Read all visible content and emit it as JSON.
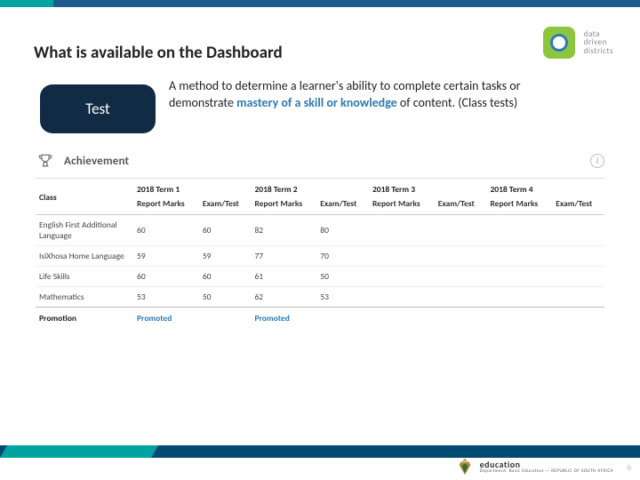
{
  "header": {
    "title": "What is available on the Dashboard",
    "logo_lines": [
      "data",
      "driven",
      "districts"
    ]
  },
  "definition": {
    "pill_label": "Test",
    "text_before": "A method to determine a learner's ability to complete certain tasks or demonstrate ",
    "text_emph": "mastery of a skill or knowledge",
    "text_after": " of content. (Class tests)"
  },
  "panel": {
    "title": "Achievement",
    "col_class": "Class",
    "terms": [
      "2018 Term 1",
      "2018 Term 2",
      "2018 Term 3",
      "2018 Term 4"
    ],
    "subcols": [
      "Report Marks",
      "Exam/Test"
    ],
    "rows": [
      {
        "class": "English First Additional Language",
        "vals": [
          "60",
          "60",
          "82",
          "80",
          "",
          "",
          "",
          ""
        ]
      },
      {
        "class": "IsiXhosa Home Language",
        "vals": [
          "59",
          "59",
          "77",
          "70",
          "",
          "",
          "",
          ""
        ]
      },
      {
        "class": "Life Skills",
        "vals": [
          "60",
          "60",
          "61",
          "50",
          "",
          "",
          "",
          ""
        ]
      },
      {
        "class": "Mathematics",
        "vals": [
          "53",
          "50",
          "62",
          "53",
          "",
          "",
          "",
          ""
        ]
      }
    ],
    "footer_label": "Promotion",
    "footer_vals": [
      "Promoted",
      "",
      "Promoted",
      "",
      "",
      "",
      "",
      ""
    ]
  },
  "footer": {
    "edu_top": "education",
    "edu_sub": "Department: Basic Education — REPUBLIC OF SOUTH AFRICA",
    "page_number": "6"
  },
  "chart_data": {
    "type": "table",
    "title": "Achievement",
    "columns": [
      "Class",
      "2018 Term 1 Report Marks",
      "2018 Term 1 Exam/Test",
      "2018 Term 2 Report Marks",
      "2018 Term 2 Exam/Test",
      "2018 Term 3 Report Marks",
      "2018 Term 3 Exam/Test",
      "2018 Term 4 Report Marks",
      "2018 Term 4 Exam/Test"
    ],
    "rows": [
      [
        "English First Additional Language",
        60,
        60,
        82,
        80,
        null,
        null,
        null,
        null
      ],
      [
        "IsiXhosa Home Language",
        59,
        59,
        77,
        70,
        null,
        null,
        null,
        null
      ],
      [
        "Life Skills",
        60,
        60,
        61,
        50,
        null,
        null,
        null,
        null
      ],
      [
        "Mathematics",
        53,
        50,
        62,
        53,
        null,
        null,
        null,
        null
      ]
    ],
    "footer": [
      "Promotion",
      "Promoted",
      "",
      "Promoted",
      "",
      "",
      "",
      "",
      ""
    ]
  }
}
